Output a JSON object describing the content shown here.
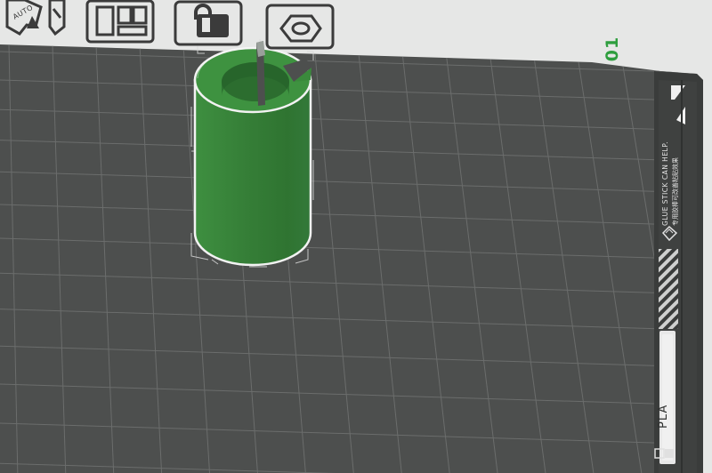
{
  "toolbar": {
    "auto_orient_label": "AUTO",
    "buttons": [
      {
        "name": "auto-orient-button",
        "icon": "auto-orient-icon"
      },
      {
        "name": "arrange-button",
        "icon": "arrange-icon"
      },
      {
        "name": "lock-button",
        "icon": "lock-icon"
      },
      {
        "name": "plate-settings-button",
        "icon": "hex-nut-icon"
      }
    ]
  },
  "plate": {
    "number": "01",
    "hint_en": "GLUE STICK CAN HELP.",
    "hint_cn": "专用胶棒可改善粘贴效果",
    "material": "PLA"
  },
  "colors": {
    "background": "#e6e7e6",
    "bed": "#4d4f4e",
    "grid_line": "#6d6f6e",
    "object_green": "#3a8a3c",
    "plate_number": "#2e9e3e"
  }
}
